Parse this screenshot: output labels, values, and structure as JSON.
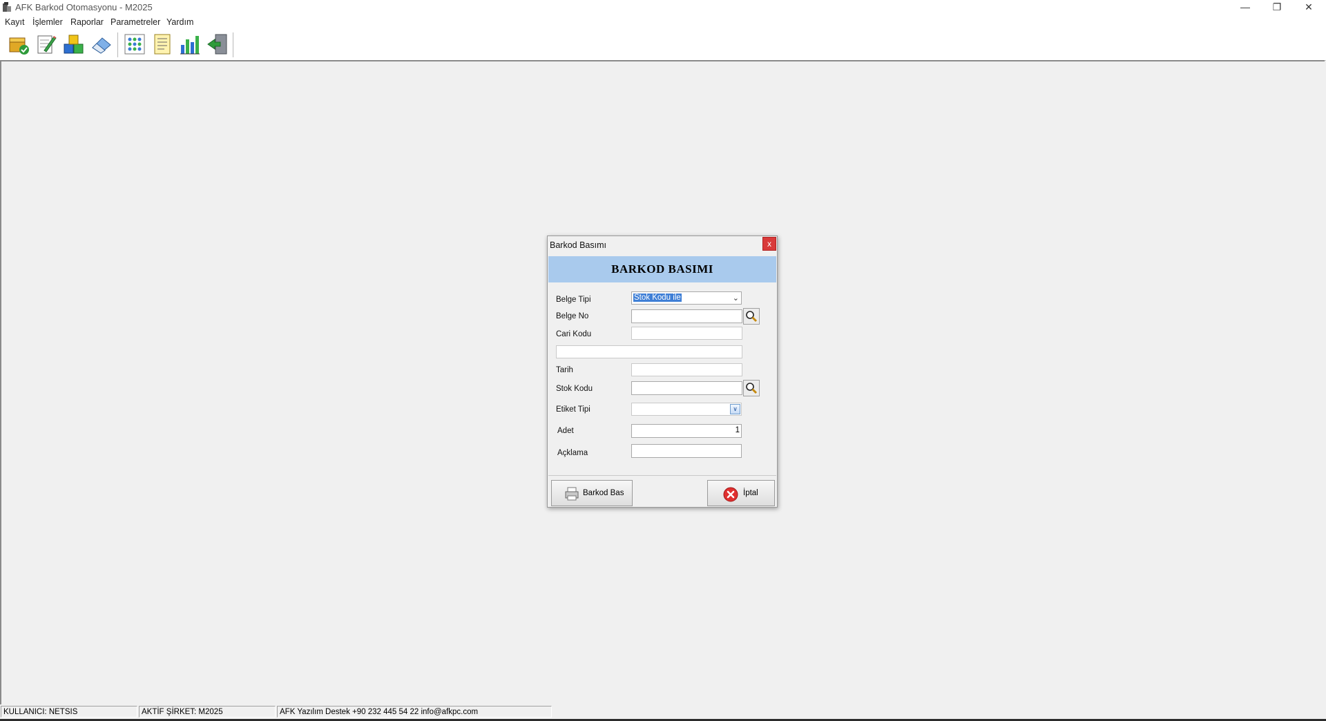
{
  "window": {
    "title": "AFK Barkod Otomasyonu  - M2025",
    "icon": "app-logo-icon",
    "controls": [
      "minimize-icon",
      "restore-icon",
      "close-icon"
    ]
  },
  "menu": [
    "Kayıt",
    "İşlemler",
    "Raporlar",
    "Parametreler",
    "Yardım"
  ],
  "toolbar": {
    "items": [
      "approve-box-icon",
      "edit-document-icon",
      "cubes-icon",
      "eraser-icon",
      "network-grid-icon",
      "list-document-icon",
      "bar-chart-icon",
      "exit-door-icon"
    ]
  },
  "dialog": {
    "title": "Barkod Basımı",
    "close_label": "x",
    "header": "BARKOD BASIMI",
    "fields": {
      "belge_tipi": {
        "label": "Belge Tipi",
        "value": "Stok Kodu ile"
      },
      "belge_no": {
        "label": "Belge No",
        "value": ""
      },
      "cari_kodu": {
        "label": "Cari Kodu",
        "value": ""
      },
      "cari_adi": {
        "value": ""
      },
      "tarih": {
        "label": "Tarih",
        "value": ""
      },
      "stok_kodu": {
        "label": "Stok Kodu",
        "value": ""
      },
      "etiket_tipi": {
        "label": "Etiket Tipi",
        "value": ""
      },
      "adet": {
        "label": "Adet",
        "value": "1"
      },
      "aciklama": {
        "label": "Açklama",
        "value": ""
      }
    },
    "buttons": {
      "print": "Barkod Bas",
      "cancel": "İptal"
    }
  },
  "status": {
    "user": "KULLANICI: NETSIS",
    "company": "AKTİF ŞİRKET: M2025",
    "support": "AFK Yazılım Destek +90 232 445 54 22    info@afkpc.com"
  },
  "colors": {
    "dialog_header": "#a9caed",
    "selection": "#3f7fd6",
    "close_button": "#d93a3a"
  }
}
